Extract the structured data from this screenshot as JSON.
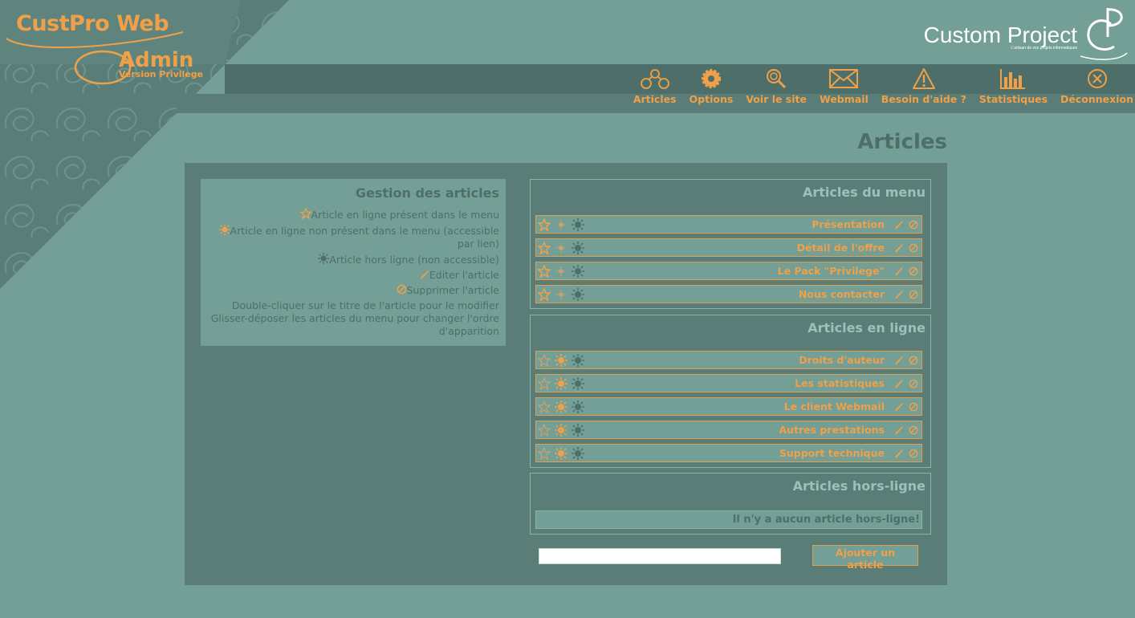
{
  "logo": {
    "main": "CustPro Web",
    "admin": "Admin",
    "version": "Version Privilege"
  },
  "brand": {
    "name": "Custom Project",
    "tagline": "L'artisan de vos projets informatiques"
  },
  "nav": [
    {
      "label": "Articles",
      "icon": "articles-icon"
    },
    {
      "label": "Options",
      "icon": "gear-icon"
    },
    {
      "label": "Voir le site",
      "icon": "magnifier-icon"
    },
    {
      "label": "Webmail",
      "icon": "envelope-icon"
    },
    {
      "label": "Besoin d'aide ?",
      "icon": "warning-icon"
    },
    {
      "label": "Statistiques",
      "icon": "bar-chart-icon"
    },
    {
      "label": "Déconnexion",
      "icon": "close-circle-icon"
    }
  ],
  "page_title": "Articles",
  "help": {
    "title": "Gestion des articles",
    "legend": [
      {
        "icon": "star-icon",
        "text": "Article en ligne présent dans le menu"
      },
      {
        "icon": "sun-icon",
        "text": "Article en ligne non présent dans le menu (accessible par lien)"
      },
      {
        "icon": "sun-dark-icon",
        "text": "Article hors ligne (non accessible)"
      },
      {
        "icon": "pencil-icon",
        "text": "Editer l'article"
      },
      {
        "icon": "delete-icon",
        "text": "Supprimer l'article"
      }
    ],
    "tips": [
      "Double-cliquer sur le titre de l'article pour le modifier",
      "Glisser-déposer les articles du menu pour changer l'ordre d'apparition"
    ]
  },
  "panels": {
    "menu": {
      "title": "Articles du menu",
      "items": [
        "Présentation",
        "Détail de l'offre",
        "Le Pack \"Privilege\"",
        "Nous contacter"
      ]
    },
    "online": {
      "title": "Articles en ligne",
      "items": [
        "Droits d'auteur",
        "Les statistiques",
        "Le client Webmail",
        "Autres prestations",
        "Support technique"
      ]
    },
    "offline": {
      "title": "Articles hors-ligne",
      "empty": "Il n'y a aucun article hors-ligne!"
    }
  },
  "new_article": {
    "value": "",
    "button_label": "Ajouter un article"
  },
  "colors": {
    "accent": "#f0a048",
    "bg": "#739f97",
    "panel": "#5a7d77",
    "dark": "#4e6f69"
  }
}
